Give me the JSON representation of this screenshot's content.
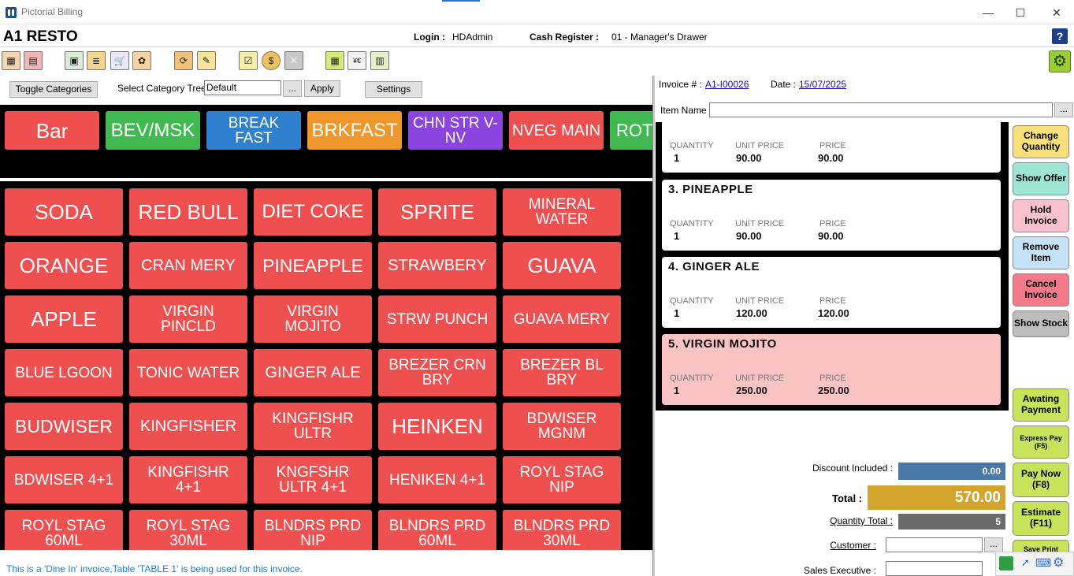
{
  "window": {
    "title": "Pictorial Billing",
    "minimize": "—",
    "maximize": "☐",
    "close": "✕"
  },
  "header": {
    "brand": "A1 RESTO",
    "login_label": "Login :",
    "login_value": "HDAdmin",
    "register_label": "Cash Register :",
    "register_value": "01 - Manager's Drawer",
    "help": "?"
  },
  "toolbar": {
    "icons": [
      "grid-icon",
      "dashboard-icon",
      "monitor-edit-icon",
      "report-icon",
      "cart-icon",
      "gift-icon",
      "refresh-icon",
      "edit-note-icon",
      "checklist-icon",
      "discount-icon",
      "void-icon",
      "calculator-icon",
      "currency-icon",
      "receipt-icon"
    ],
    "settings_icon": "⚙"
  },
  "controls": {
    "toggle_categories": "Toggle Categories",
    "category_tree_label": "Select Category Tree :",
    "category_tree_value": "Default",
    "browse": "...",
    "apply": "Apply",
    "settings": "Settings"
  },
  "categories": [
    {
      "label": "Bar",
      "color": "#ee5050"
    },
    {
      "label": "BEV/MSK",
      "color": "#3fb950"
    },
    {
      "label": "BREAK FAST",
      "color": "#2f80d0"
    },
    {
      "label": "BRKFAST",
      "color": "#f0962a"
    },
    {
      "label": "CHN STR V-NV",
      "color": "#8a44e0"
    },
    {
      "label": "NVEG MAIN",
      "color": "#ee5050"
    },
    {
      "label": "ROT",
      "color": "#3fb950"
    }
  ],
  "items": [
    [
      "SODA",
      "RED BULL",
      "DIET COKE",
      "SPRITE",
      "MINERAL WATER"
    ],
    [
      "ORANGE",
      "CRAN MERY",
      "PINEAPPLE",
      "STRAWBERY",
      "GUAVA"
    ],
    [
      "APPLE",
      "VIRGIN PINCLD",
      "VIRGIN MOJITO",
      "STRW PUNCH",
      "GUAVA MERY"
    ],
    [
      "BLUE LGOON",
      "TONIC WATER",
      "GINGER ALE",
      "BREZER CRN BRY",
      "BREZER BL BRY"
    ],
    [
      "BUDWISER",
      "KINGFISHER",
      "KINGFISHR ULTR",
      "HEINKEN",
      "BDWISER MGNM"
    ],
    [
      "BDWISER 4+1",
      "KINGFISHR 4+1",
      "KNGFSHR ULTR 4+1",
      "HENIKEN 4+1",
      "ROYL STAG NIP"
    ],
    [
      "ROYL STAG 60ML",
      "ROYL STAG 30ML",
      "BLNDRS PRD NIP",
      "BLNDRS PRD 60ML",
      "BLNDRS PRD 30ML"
    ]
  ],
  "status": {
    "message": "This is a 'Dine In' invoice,Table 'TABLE 1' is being used for this invoice."
  },
  "invoice": {
    "number_label": "Invoice # :",
    "number": "A1-I00026",
    "date_label": "Date :",
    "date": "15/07/2025",
    "item_name_label": "Item Name :",
    "col_quantity": "QUANTITY",
    "col_unit_price": "UNIT PRICE",
    "col_price": "PRICE",
    "lines": [
      {
        "name": "",
        "qty": "1",
        "unit": "90.00",
        "price": "90.00"
      },
      {
        "name": "3. PINEAPPLE",
        "qty": "1",
        "unit": "90.00",
        "price": "90.00"
      },
      {
        "name": "4. GINGER ALE",
        "qty": "1",
        "unit": "120.00",
        "price": "120.00"
      },
      {
        "name": "5. VIRGIN MOJITO",
        "qty": "1",
        "unit": "250.00",
        "price": "250.00"
      }
    ],
    "discount_label": "Discount Included :",
    "discount": "0.00",
    "total_label": "Total :",
    "total": "570.00",
    "qty_total_label": "Quantity Total :",
    "qty_total": "5",
    "customer_label": "Customer :",
    "sales_exec_label": "Sales Executive :"
  },
  "side_buttons": [
    {
      "label": "Change Quantity",
      "color": "#f7e07a"
    },
    {
      "label": "Show Offer",
      "color": "#9de6d6"
    },
    {
      "label": "Hold Invoice",
      "color": "#f7c1cf"
    },
    {
      "label": "Remove Item",
      "color": "#c6e2f7"
    },
    {
      "label": "Cancel Invoice",
      "color": "#f27a8a"
    },
    {
      "label": "Show Stock",
      "color": "#bdbdbd"
    }
  ],
  "pay_buttons": [
    {
      "label": "Awating Payment",
      "color": "#c8e35a"
    },
    {
      "label": "Express Pay (F5)",
      "color": "#c8e35a"
    },
    {
      "label": "Pay Now (F8)",
      "color": "#c8e35a"
    },
    {
      "label": "Estimate (F11)",
      "color": "#c8e35a"
    },
    {
      "label": "Save Print",
      "color": "#c8e35a"
    }
  ]
}
